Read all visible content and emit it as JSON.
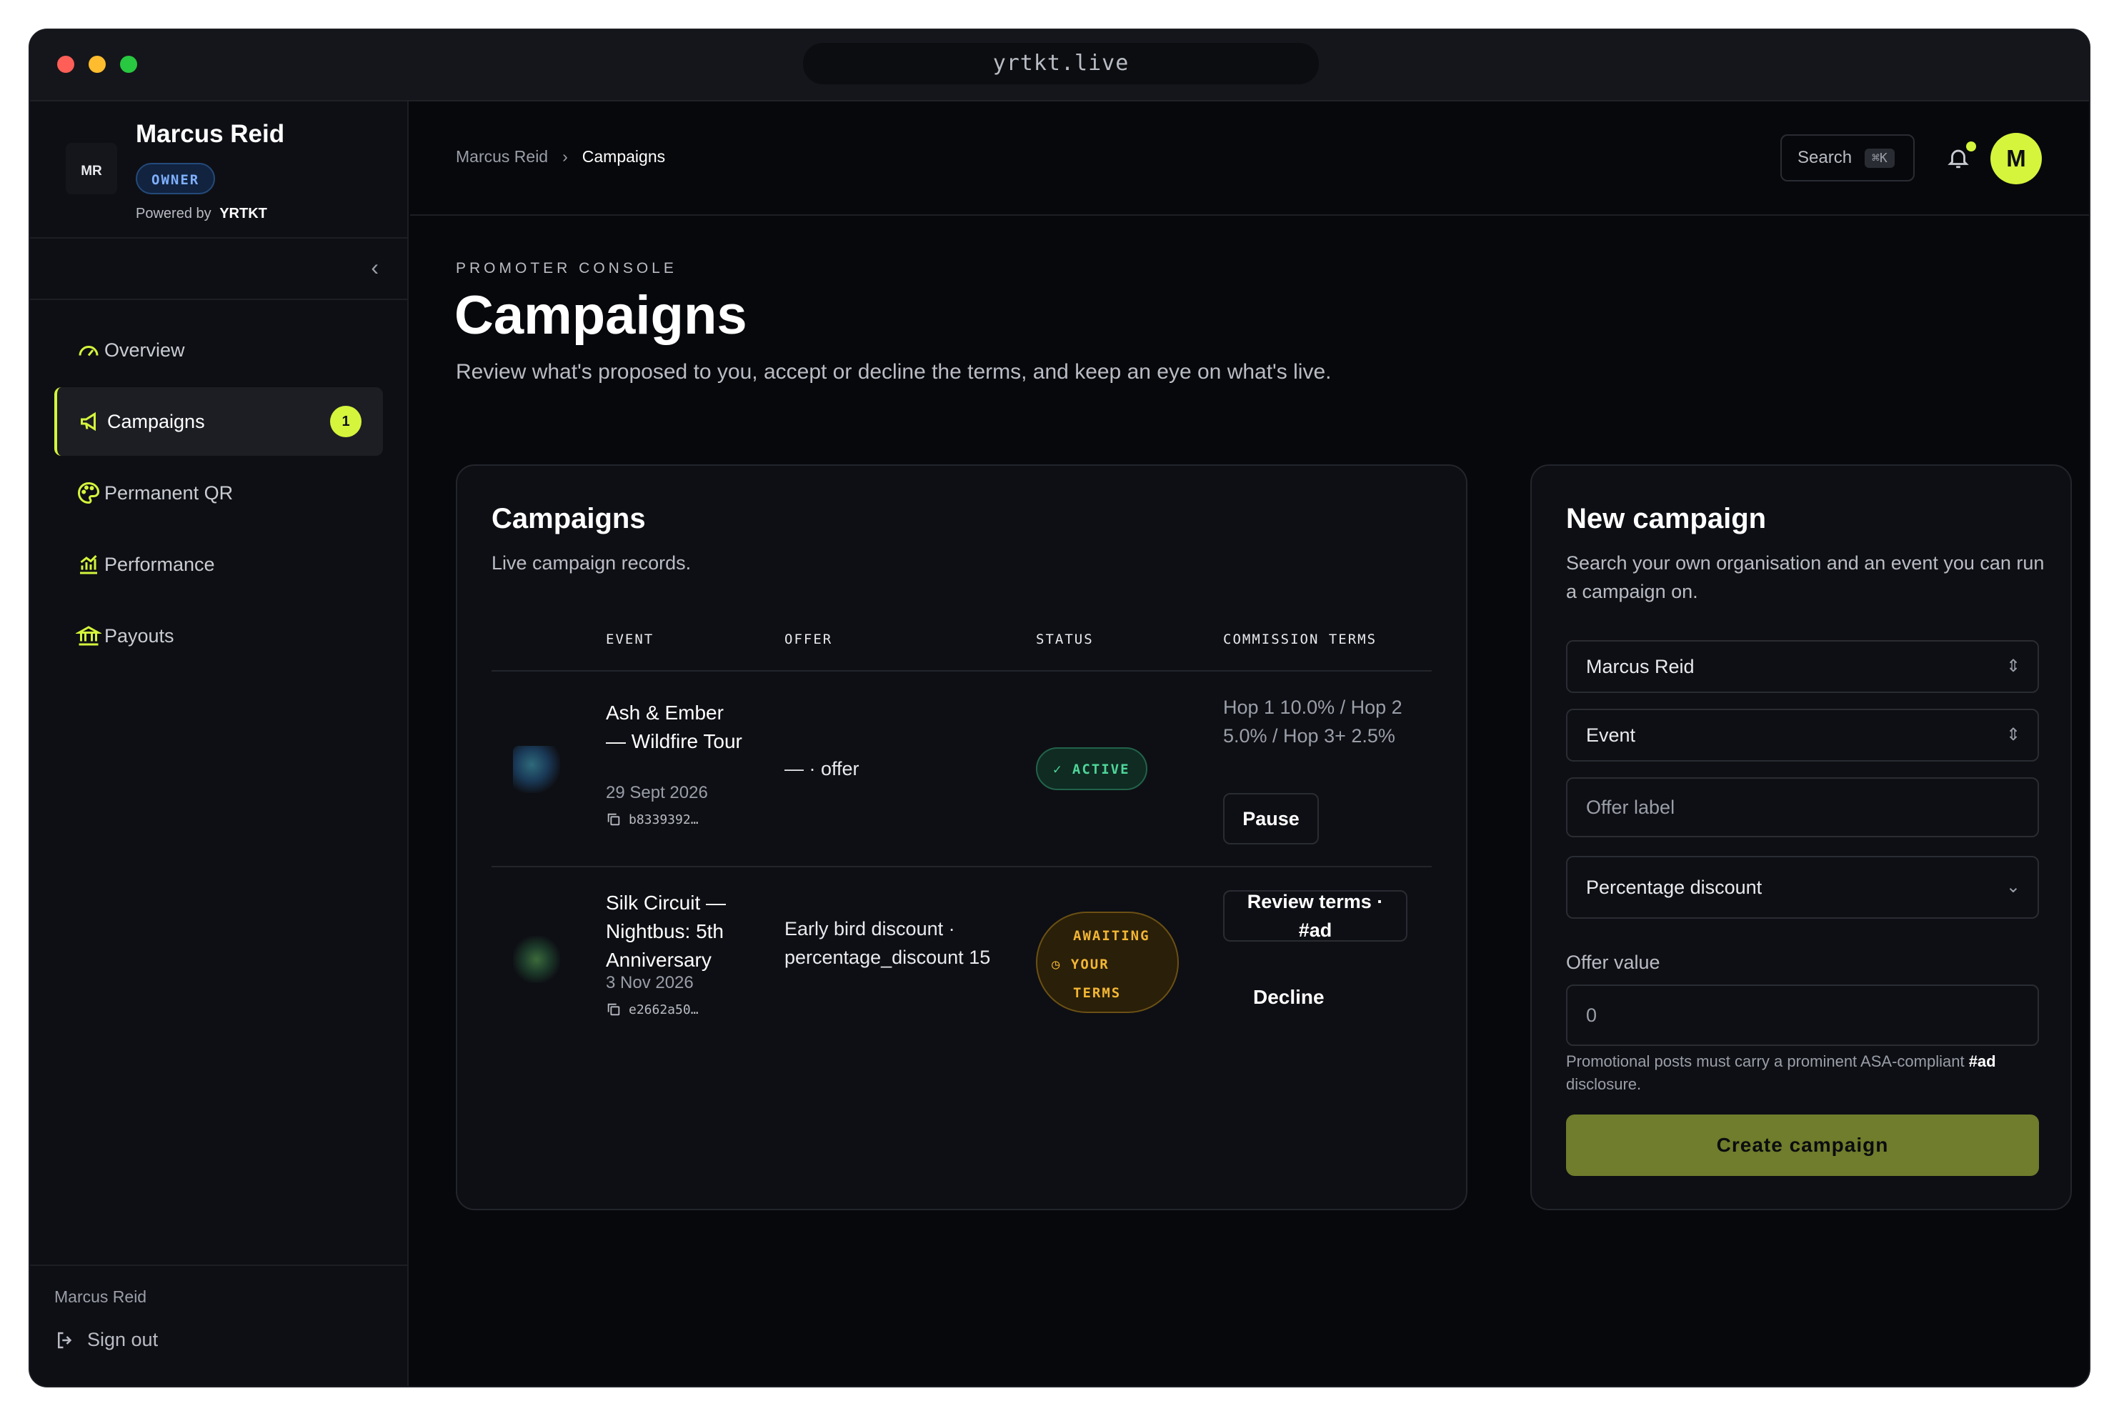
{
  "browser": {
    "url": "yrtkt.live"
  },
  "sidebar": {
    "logo_text": "MR",
    "org_name": "Marcus Reid",
    "role_badge": "OWNER",
    "powered_by": "Powered by",
    "powered_brand": "YRTKT",
    "items": [
      {
        "label": "Overview",
        "icon": "gauge-icon"
      },
      {
        "label": "Campaigns",
        "icon": "megaphone-icon",
        "badge": "1"
      },
      {
        "label": "Permanent QR",
        "icon": "palette-icon"
      },
      {
        "label": "Performance",
        "icon": "chart-icon"
      },
      {
        "label": "Payouts",
        "icon": "bank-icon"
      }
    ],
    "footer_user": "Marcus Reid",
    "sign_out": "Sign out"
  },
  "header": {
    "breadcrumb": [
      "Marcus Reid",
      "Campaigns"
    ],
    "search_label": "Search",
    "search_shortcut": "⌘K",
    "avatar_initial": "M"
  },
  "page": {
    "eyebrow": "PROMOTER CONSOLE",
    "title": "Campaigns",
    "subtitle": "Review what's proposed to you, accept or decline the terms, and keep an eye on what's live."
  },
  "campaigns": {
    "title": "Campaigns",
    "subtitle": "Live campaign records.",
    "columns": [
      "EVENT",
      "OFFER",
      "STATUS",
      "COMMISSION TERMS"
    ],
    "rows": [
      {
        "event": "Ash & Ember — Wildfire Tour",
        "date": "29 Sept 2026",
        "id": "b8339392…",
        "offer": "— · offer",
        "status": "ACTIVE",
        "terms": "Hop 1 10.0% / Hop 2 5.0% / Hop 3+ 2.5%",
        "action": "Pause"
      },
      {
        "event": "Silk Circuit — Nightbus: 5th Anniversary",
        "date": "3 Nov 2026",
        "id": "e2662a50…",
        "offer": "Early bird discount · percentage_discount 15",
        "status": "AWAITING YOUR TERMS",
        "action": "Review terms · #ad",
        "secondary_action": "Decline"
      }
    ]
  },
  "new_campaign": {
    "title": "New campaign",
    "subtitle": "Search your own organisation and an event you can run a campaign on.",
    "org_select": "Marcus Reid",
    "event_placeholder": "Event",
    "offer_label_placeholder": "Offer label",
    "offer_type": "Percentage discount",
    "offer_value_label": "Offer value",
    "offer_value_placeholder": "0",
    "disclaimer_prefix": "Promotional posts must carry a prominent ASA-compliant",
    "disclaimer_tag": "#ad",
    "disclaimer_suffix": "disclosure.",
    "submit": "Create campaign"
  }
}
